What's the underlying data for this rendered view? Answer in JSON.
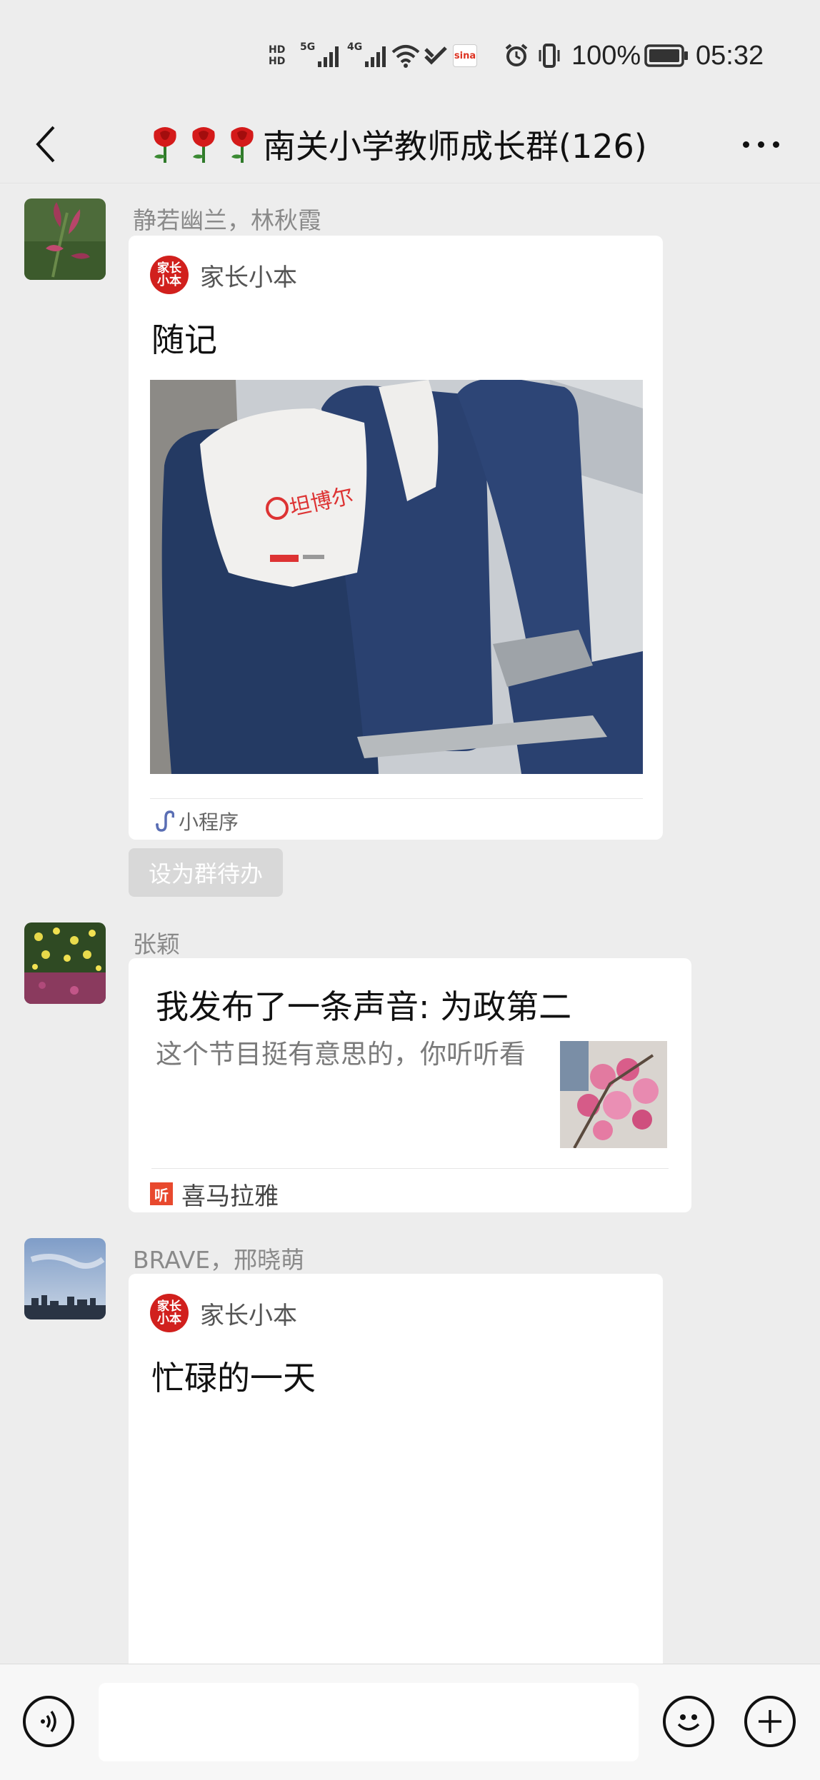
{
  "status_bar": {
    "hd1": "HD",
    "hd2": "HD",
    "net1": "5G",
    "net2": "4G",
    "battery_percent": "100%",
    "time": "05:32",
    "icons": [
      "signal-icon",
      "wifi-icon",
      "nfc-icon",
      "sina-weibo-icon",
      "alarm-icon",
      "vibrate-icon",
      "battery-icon"
    ]
  },
  "nav": {
    "title": "南关小学教师成长群(126)",
    "back_icon": "chevron-left-icon",
    "more_icon": "more-dots-icon"
  },
  "messages": [
    {
      "sender": "静若幽兰，林秋霞",
      "type": "mini-program",
      "app_name": "家长小本",
      "app_logo_text": "家长小本",
      "title": "随记",
      "footer": "小程序",
      "image_text": "坦博尔"
    },
    {
      "sender": "张颖",
      "type": "audio-share",
      "title": "我发布了一条声音: 为政第二",
      "description": "这个节目挺有意思的，你听听看",
      "source": "喜马拉雅",
      "source_logo_text": "听"
    },
    {
      "sender": "BRAVE，邢晓萌",
      "type": "mini-program",
      "app_name": "家长小本",
      "app_logo_text": "家长小本",
      "title": "忙碌的一天"
    }
  ],
  "todo_button": "设为群待办",
  "bottom_bar": {
    "voice_icon": "voice-icon",
    "emoji_icon": "emoji-icon",
    "plus_icon": "plus-icon",
    "input_value": ""
  }
}
